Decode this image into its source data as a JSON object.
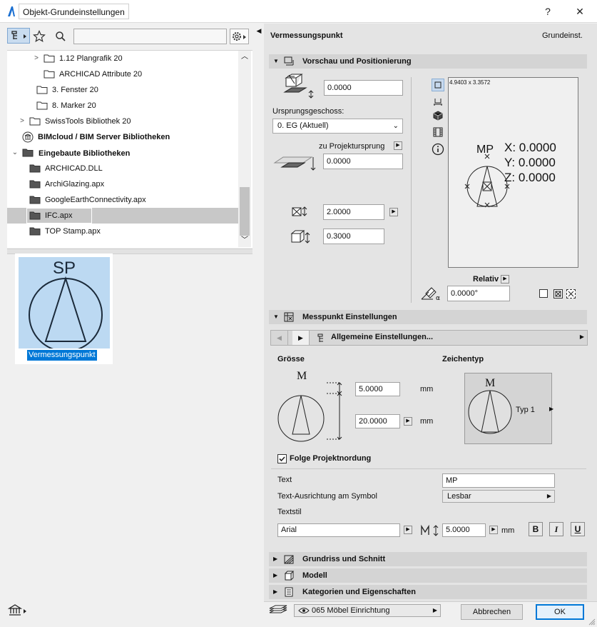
{
  "window": {
    "title": "Objekt-Grundeinstellungen",
    "help": "?",
    "close": "✕"
  },
  "library": {
    "search_value": "",
    "tree": [
      {
        "label": "1.12 Plangrafik 20",
        "bold": false
      },
      {
        "label": "ARCHICAD Attribute 20",
        "bold": false
      },
      {
        "label": "3. Fenster 20",
        "bold": false
      },
      {
        "label": "8. Marker 20",
        "bold": false
      },
      {
        "label": "SwissTools Bibliothek 20",
        "bold": false
      },
      {
        "label": "BIMcloud / BIM Server Bibliotheken",
        "bold": true
      },
      {
        "label": "Eingebaute Bibliotheken",
        "bold": true
      },
      {
        "label": "ARCHICAD.DLL",
        "bold": false
      },
      {
        "label": "ArchiGlazing.apx",
        "bold": false
      },
      {
        "label": "GoogleEarthConnectivity.apx",
        "bold": false
      },
      {
        "label": "IFC.apx",
        "bold": false
      },
      {
        "label": "TOP Stamp.apx",
        "bold": false
      }
    ],
    "preview": {
      "symbol_text": "SP",
      "caption": "Vermessungspunkt"
    }
  },
  "panel": {
    "title": "Vermessungspunkt",
    "right_label": "Grundeinst.",
    "sections": {
      "vorschau": "Vorschau und Positionierung",
      "messpunkt": "Messpunkt Einstellungen",
      "grundriss": "Grundriss und Schnitt",
      "modell": "Modell",
      "kategorien": "Kategorien und Eigenschaften"
    },
    "positioning": {
      "elevation": "0.0000",
      "ursprung_label": "Ursprungsgeschoss:",
      "ursprung_value": "0. EG (Aktuell)",
      "projekt_label": "zu Projektursprung",
      "projekt_value": "0.0000",
      "width": "2.0000",
      "height": "0.3000",
      "canvas_size": "4.9403 x 3.3572",
      "canvas_label": "MP",
      "canvas_x": "X: 0.0000",
      "canvas_y": "Y: 0.0000",
      "canvas_z": "Z: 0.0000",
      "relativ_label": "Relativ",
      "angle": "0.0000°"
    },
    "messpunkt": {
      "nav_label": "Allgemeine Einstellungen...",
      "groesse_label": "Grösse",
      "zeichentyp_label": "Zeichentyp",
      "symbol_letter": "M",
      "size1": "5.0000",
      "size2": "20.0000",
      "unit": "mm",
      "typ": "Typ 1",
      "north_label": "Folge Projektnordung",
      "text_label": "Text",
      "text_value": "MP",
      "align_label": "Text-Ausrichtung am Symbol",
      "align_value": "Lesbar",
      "textstil_label": "Textstil",
      "font_value": "Arial",
      "font_size": "5.0000",
      "font_unit": "mm",
      "bold": "B",
      "italic": "I",
      "underline": "U"
    },
    "footer": {
      "layer": "065 Möbel Einrichtung",
      "cancel": "Abbrechen",
      "ok": "OK"
    }
  }
}
